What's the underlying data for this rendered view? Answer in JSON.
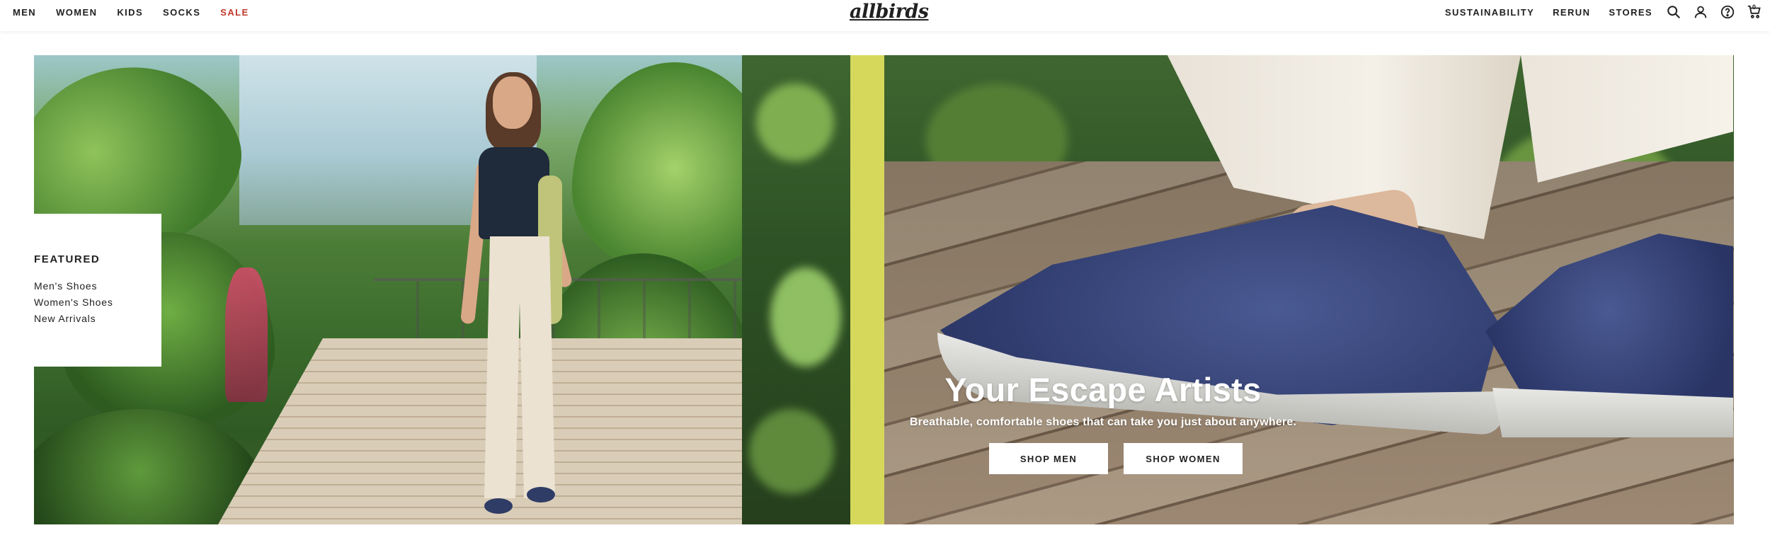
{
  "header": {
    "nav_left": [
      "MEN",
      "WOMEN",
      "KIDS",
      "SOCKS",
      "SALE"
    ],
    "logo_text": "allbirds",
    "nav_right": [
      "SUSTAINABILITY",
      "RERUN",
      "STORES"
    ],
    "cart_count": "0",
    "icons": [
      "search-icon",
      "account-icon",
      "help-icon",
      "cart-icon"
    ],
    "sale_color": "#c0392b"
  },
  "featured": {
    "title": "FEATURED",
    "links": [
      "Men's Shoes",
      "Women's Shoes",
      "New Arrivals"
    ]
  },
  "hero": {
    "headline": "Your Escape Artists",
    "subheadline": "Breathable, comfortable shoes that can take you just about anywhere.",
    "cta_men": "SHOP MEN",
    "cta_women": "SHOP WOMEN",
    "accent_color": "#d6d85c"
  }
}
